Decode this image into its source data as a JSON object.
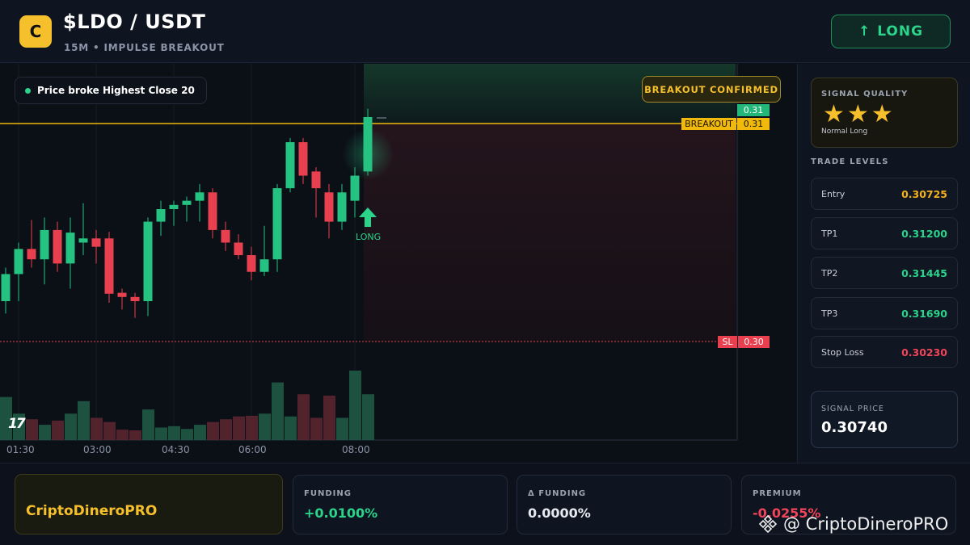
{
  "header": {
    "logo_letter": "C",
    "pair": "$LDO / USDT",
    "subtitle": "15M • IMPULSE BREAKOUT",
    "direction_arrow": "↑",
    "direction_label": "LONG"
  },
  "chart": {
    "note": "Price broke Highest Close 20",
    "badge": "BREAKOUT CONFIRMED",
    "price_tag_current": "0.31",
    "breakout_label": "BREAKOUT",
    "breakout_value": "0.31",
    "sl_label": "SL",
    "sl_value": "0.30",
    "signal_label": "LONG",
    "tv_logo": "17",
    "time_labels": [
      "01:30",
      "03:00",
      "04:30",
      "06:00",
      "08:00"
    ],
    "colors": {
      "up": "#26c281",
      "down": "#e8404f",
      "breakout_line": "#f0b90b",
      "stop_line": "#e8404f"
    }
  },
  "chart_data": {
    "type": "candlestick",
    "breakout_level": 0.31,
    "stop_level": 0.3,
    "candles": [
      {
        "o": 0.30122,
        "h": 0.30306,
        "l": 0.30054,
        "c": 0.30271
      },
      {
        "o": 0.30271,
        "h": 0.30444,
        "l": 0.30122,
        "c": 0.30409
      },
      {
        "o": 0.30409,
        "h": 0.30568,
        "l": 0.30306,
        "c": 0.30352
      },
      {
        "o": 0.30352,
        "h": 0.30582,
        "l": 0.30214,
        "c": 0.30513
      },
      {
        "o": 0.30513,
        "h": 0.30559,
        "l": 0.30283,
        "c": 0.30329
      },
      {
        "o": 0.30329,
        "h": 0.30582,
        "l": 0.30191,
        "c": 0.30499
      },
      {
        "o": 0.30444,
        "h": 0.30661,
        "l": 0.30375,
        "c": 0.30467
      },
      {
        "o": 0.30467,
        "h": 0.30513,
        "l": 0.30329,
        "c": 0.30421
      },
      {
        "o": 0.30467,
        "h": 0.30503,
        "l": 0.30113,
        "c": 0.30163
      },
      {
        "o": 0.30168,
        "h": 0.30191,
        "l": 0.30076,
        "c": 0.30145
      },
      {
        "o": 0.30145,
        "h": 0.30168,
        "l": 0.3003,
        "c": 0.30122
      },
      {
        "o": 0.30122,
        "h": 0.30582,
        "l": 0.3004,
        "c": 0.30559
      },
      {
        "o": 0.30559,
        "h": 0.30674,
        "l": 0.30481,
        "c": 0.30628
      },
      {
        "o": 0.30628,
        "h": 0.30674,
        "l": 0.30536,
        "c": 0.30651
      },
      {
        "o": 0.30651,
        "h": 0.30697,
        "l": 0.30559,
        "c": 0.30674
      },
      {
        "o": 0.30674,
        "h": 0.30766,
        "l": 0.30559,
        "c": 0.3072
      },
      {
        "o": 0.3072,
        "h": 0.30743,
        "l": 0.30467,
        "c": 0.30513
      },
      {
        "o": 0.30513,
        "h": 0.30559,
        "l": 0.30398,
        "c": 0.30444
      },
      {
        "o": 0.30444,
        "h": 0.3049,
        "l": 0.30352,
        "c": 0.30375
      },
      {
        "o": 0.30375,
        "h": 0.30421,
        "l": 0.30237,
        "c": 0.30283
      },
      {
        "o": 0.30283,
        "h": 0.30536,
        "l": 0.3026,
        "c": 0.30352
      },
      {
        "o": 0.30352,
        "h": 0.30766,
        "l": 0.30283,
        "c": 0.30743
      },
      {
        "o": 0.30743,
        "h": 0.31019,
        "l": 0.3072,
        "c": 0.30996
      },
      {
        "o": 0.30996,
        "h": 0.31019,
        "l": 0.30766,
        "c": 0.30812
      },
      {
        "o": 0.30835,
        "h": 0.30858,
        "l": 0.30582,
        "c": 0.30743
      },
      {
        "o": 0.3072,
        "h": 0.30766,
        "l": 0.30467,
        "c": 0.30559
      },
      {
        "o": 0.30559,
        "h": 0.30766,
        "l": 0.30513,
        "c": 0.3072
      },
      {
        "o": 0.30674,
        "h": 0.30858,
        "l": 0.30582,
        "c": 0.30812
      },
      {
        "o": 0.30835,
        "h": 0.3118,
        "l": 0.30812,
        "c": 0.31134
      }
    ],
    "volumes": [
      0.62,
      0.38,
      0.3,
      0.22,
      0.28,
      0.38,
      0.56,
      0.32,
      0.26,
      0.15,
      0.14,
      0.44,
      0.18,
      0.2,
      0.16,
      0.22,
      0.26,
      0.3,
      0.34,
      0.35,
      0.38,
      0.83,
      0.34,
      0.66,
      0.32,
      0.64,
      0.32,
      1.0,
      0.66
    ]
  },
  "side": {
    "quality_title": "SIGNAL QUALITY",
    "stars": "★★★",
    "quality_desc": "Normal Long",
    "levels_title": "TRADE LEVELS",
    "levels": [
      {
        "label": "Entry",
        "value": "0.30725",
        "color": "#f5b021"
      },
      {
        "label": "TP1",
        "value": "0.31200",
        "color": "#2bd38b"
      },
      {
        "label": "TP2",
        "value": "0.31445",
        "color": "#2bd38b"
      },
      {
        "label": "TP3",
        "value": "0.31690",
        "color": "#2bd38b"
      },
      {
        "label": "Stop Loss",
        "value": "0.30230",
        "color": "#f0445a"
      }
    ],
    "signal_title": "SIGNAL PRICE",
    "signal_value": "0.30740"
  },
  "bottom": {
    "brand": "CriptoDineroPRO",
    "cards": [
      {
        "label": "FUNDING",
        "value": "+0.0100%",
        "color": "#2bd38b"
      },
      {
        "label": "Δ FUNDING",
        "value": "0.0000%",
        "color": "#e6e9ef"
      },
      {
        "label": "PREMIUM",
        "value": "-0.0255%",
        "color": "#f0445a"
      }
    ],
    "watermark": "@ CriptoDineroPRO"
  }
}
